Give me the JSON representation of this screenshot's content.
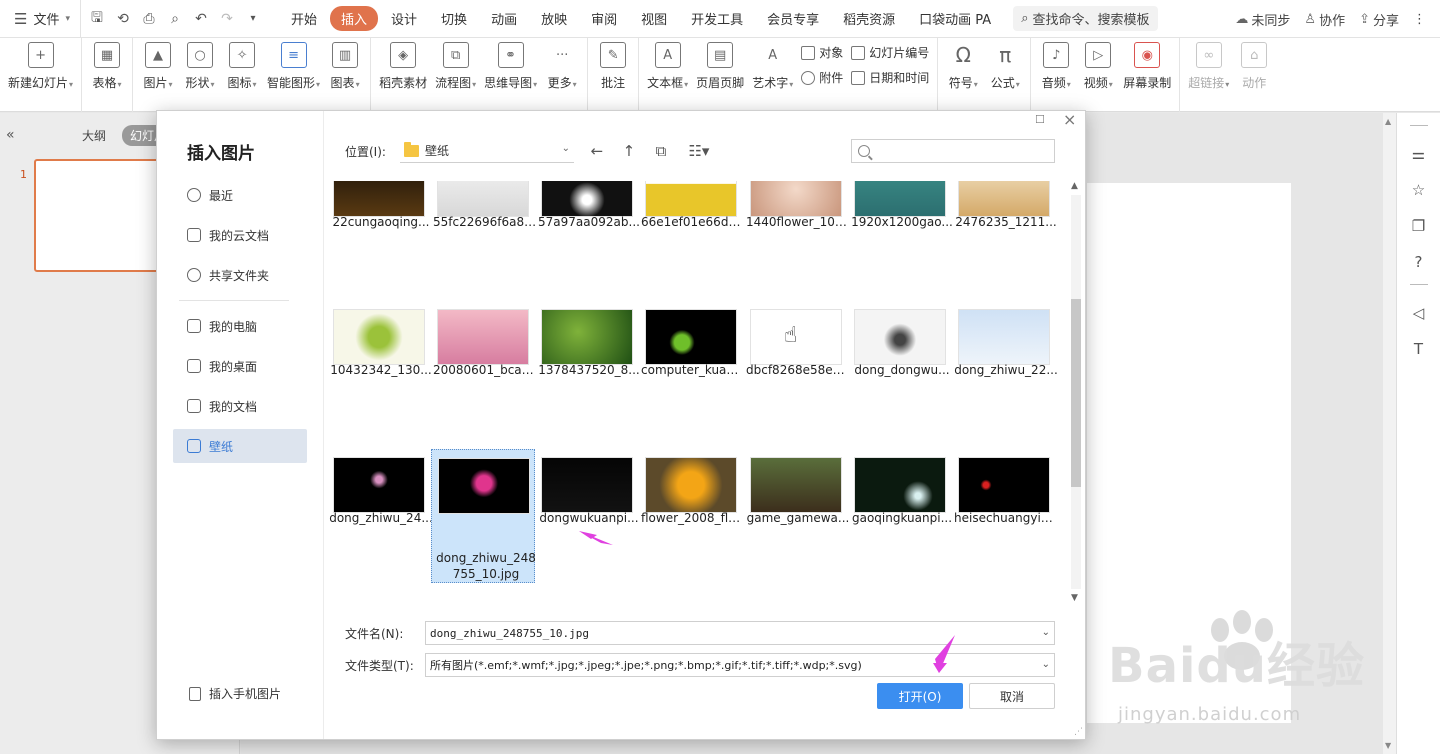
{
  "menubar": {
    "file_label": "文件",
    "tabs": [
      "开始",
      "插入",
      "设计",
      "切换",
      "动画",
      "放映",
      "审阅",
      "视图",
      "开发工具",
      "会员专享",
      "稻壳资源",
      "口袋动画 PA"
    ],
    "active_tab": "插入",
    "search_label": "查找命令、搜索模板",
    "right_items": [
      "未同步",
      "协作",
      "分享"
    ]
  },
  "ribbon": {
    "new_slide": "新建幻灯片",
    "table": "表格",
    "picture": "图片",
    "shape": "形状",
    "icon": "图标",
    "smart_shape": "智能图形",
    "chart": "图表",
    "material": "稻壳素材",
    "flowchart": "流程图",
    "mindmap": "思维导图",
    "more": "更多",
    "comment": "批注",
    "textbox": "文本框",
    "header_footer": "页眉页脚",
    "art_text": "艺术字",
    "object": "对象",
    "attachment": "附件",
    "slide_number": "幻灯片编号",
    "date_time": "日期和时间",
    "symbol": "符号",
    "formula": "公式",
    "audio": "音频",
    "video": "视频",
    "screen_record": "屏幕录制",
    "hyperlink": "超链接",
    "action": "动作"
  },
  "leftpanel": {
    "tab_outline": "大纲",
    "tab_slides": "幻灯片",
    "slide_number": "1"
  },
  "dialog": {
    "title": "插入图片",
    "nav": [
      "最近",
      "我的云文档",
      "共享文件夹",
      "我的电脑",
      "我的桌面",
      "我的文档",
      "壁纸"
    ],
    "selected_nav": "壁纸",
    "phone_link": "插入手机图片",
    "location_label": "位置(I):",
    "location_value": "壁纸",
    "search_placeholder": "",
    "filename_label": "文件名(N):",
    "filename_value": "dong_zhiwu_248755_10.jpg",
    "filetype_label": "文件类型(T):",
    "filetype_value": "所有图片(*.emf;*.wmf;*.jpg;*.jpeg;*.jpe;*.png;*.bmp;*.gif;*.tif;*.tiff;*.wdp;*.svg)",
    "open_button": "打开(O)",
    "cancel_button": "取消"
  },
  "files": [
    [
      "22cungaoqing...",
      "55fc22696f6a89...",
      "57a97aa092ab...",
      "66e1ef01e66d6...",
      "1440flower_100...",
      "1920x1200gao...",
      "2476235_1211..."
    ],
    [
      "10432342_130...",
      "20080601_bcae...",
      "1378437520_8...",
      "computer_kuan...",
      "dbcf8268e58e4...",
      "dong_dongwu...",
      "dong_zhiwu_22..."
    ],
    [
      "dong_zhiwu_24...",
      "dong_zhiwu_248755_10.jpg",
      "dongwukuanpi...",
      "flower_2008_flo...",
      "game_gamewa...",
      "gaoqingkuanpi...",
      "heisechuangyib..."
    ]
  ],
  "selected_file": "dong_zhiwu_248755_10.jpg",
  "watermark": {
    "brand": "Baidu经验",
    "url": "jingyan.baidu.com"
  },
  "colors": {
    "accent_tab": "#e0734c",
    "primary_button": "#3b8ef0",
    "selection": "#cce4fa",
    "annotation_arrow": "#e040e0"
  }
}
